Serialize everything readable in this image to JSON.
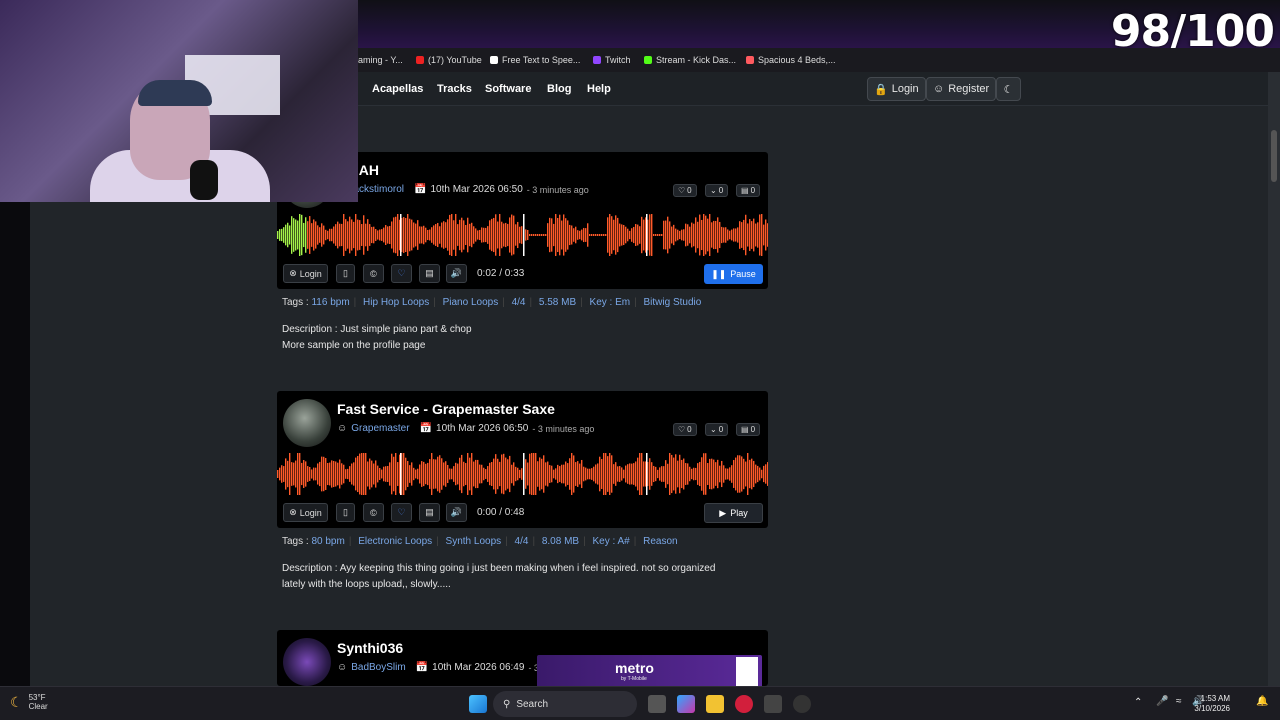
{
  "stream": {
    "score": "98/100"
  },
  "bookmarks": [
    {
      "label": "aming - Y..."
    },
    {
      "label": "(17) YouTube"
    },
    {
      "label": "Free Text to Spee..."
    },
    {
      "label": "Twitch"
    },
    {
      "label": "Stream - Kick Das..."
    },
    {
      "label": "Spacious 4 Beds,..."
    }
  ],
  "nav": {
    "links": [
      "Acapellas",
      "Tracks",
      "Software",
      "Blog",
      "Help"
    ],
    "login": "Login",
    "register": "Register"
  },
  "tracks": [
    {
      "title": "RMAH",
      "user": "lackstimorol",
      "date": "10th Mar 2026 06:50",
      "ago": "- 3 minutes ago",
      "likes": "0",
      "dislikes": "0",
      "comments": "0",
      "login": "Login",
      "time": "0:02 / 0:33",
      "action": "Pause",
      "played_fraction": 0.06,
      "tags_label": "Tags :",
      "tags": [
        "116 bpm",
        "Hip Hop Loops",
        "Piano Loops",
        "4/4",
        "5.58 MB",
        "Key : Em",
        "Bitwig Studio"
      ],
      "description": [
        "Description : Just simple piano part & chop",
        "More sample on the profile page"
      ]
    },
    {
      "title": "Fast Service - Grapemaster Saxe",
      "user": "Grapemaster",
      "date": "10th Mar 2026 06:50",
      "ago": "- 3 minutes ago",
      "likes": "0",
      "dislikes": "0",
      "comments": "0",
      "login": "Login",
      "time": "0:00 / 0:48",
      "action": "Play",
      "played_fraction": 0,
      "tags_label": "Tags :",
      "tags": [
        "80 bpm",
        "Electronic Loops",
        "Synth Loops",
        "4/4",
        "8.08 MB",
        "Key : A#",
        "Reason"
      ],
      "description": [
        "Description : Ayy keeping this thing going i just been making when i feel inspired. not so organized",
        "lately with the loops upload,, slowly....."
      ]
    },
    {
      "title": "Synthi036",
      "user": "BadBoySlim",
      "date": "10th Mar 2026 06:49",
      "ago": "- 3"
    }
  ],
  "ad": {
    "brand": "metro",
    "sub": "by T-Mobile"
  },
  "taskbar": {
    "temp": "53°F",
    "condition": "Clear",
    "search": "Search",
    "time": "1:53 AM",
    "date": "3/10/2026"
  },
  "colors": {
    "wave": "#ff5a2a",
    "played": "#a6f24a",
    "pause": "#1f6feb",
    "link": "#7aa7e6"
  }
}
